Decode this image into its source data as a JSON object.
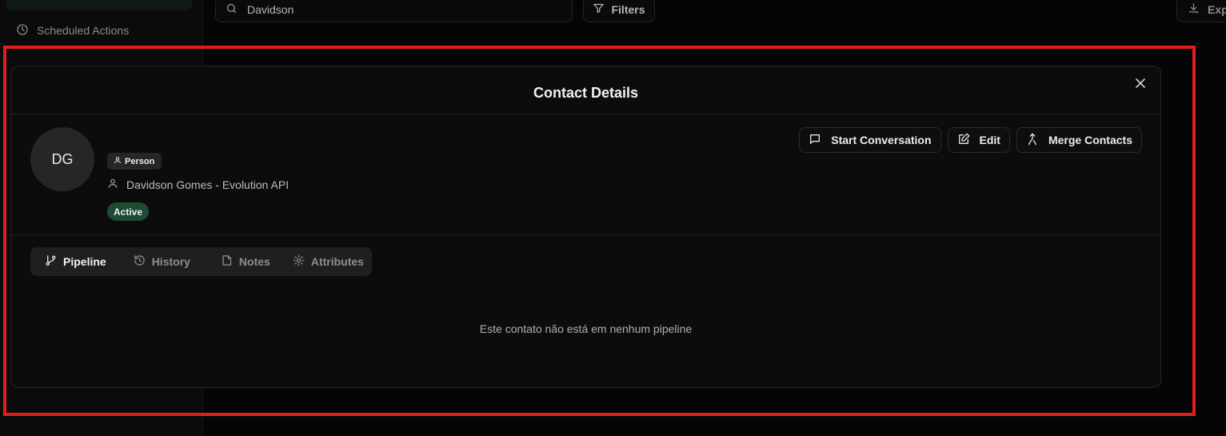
{
  "sidebar": {
    "scheduled_actions_label": "Scheduled Actions"
  },
  "toolbar": {
    "search_value": "Davidson",
    "filters_label": "Filters",
    "export_label": "Export"
  },
  "modal": {
    "title": "Contact Details",
    "contact": {
      "initials": "DG",
      "type_label": "Person",
      "name": "Davidson Gomes - Evolution API",
      "status": "Active"
    },
    "actions": {
      "start_conversation": "Start Conversation",
      "edit": "Edit",
      "merge_contacts": "Merge Contacts"
    },
    "tabs": [
      {
        "label": "Pipeline",
        "icon": "git-branch-icon",
        "active": true
      },
      {
        "label": "History",
        "icon": "history-icon",
        "active": false
      },
      {
        "label": "Notes",
        "icon": "note-icon",
        "active": false
      },
      {
        "label": "Attributes",
        "icon": "gear-icon",
        "active": false
      }
    ],
    "empty_message": "Este contato não está em nenhum pipeline"
  },
  "colors": {
    "background": "#050505",
    "modal_background": "#0c0c0c",
    "status_active": "#1f4a33",
    "highlight_frame": "#e01e1e",
    "accent_green": "#1f9d55"
  }
}
